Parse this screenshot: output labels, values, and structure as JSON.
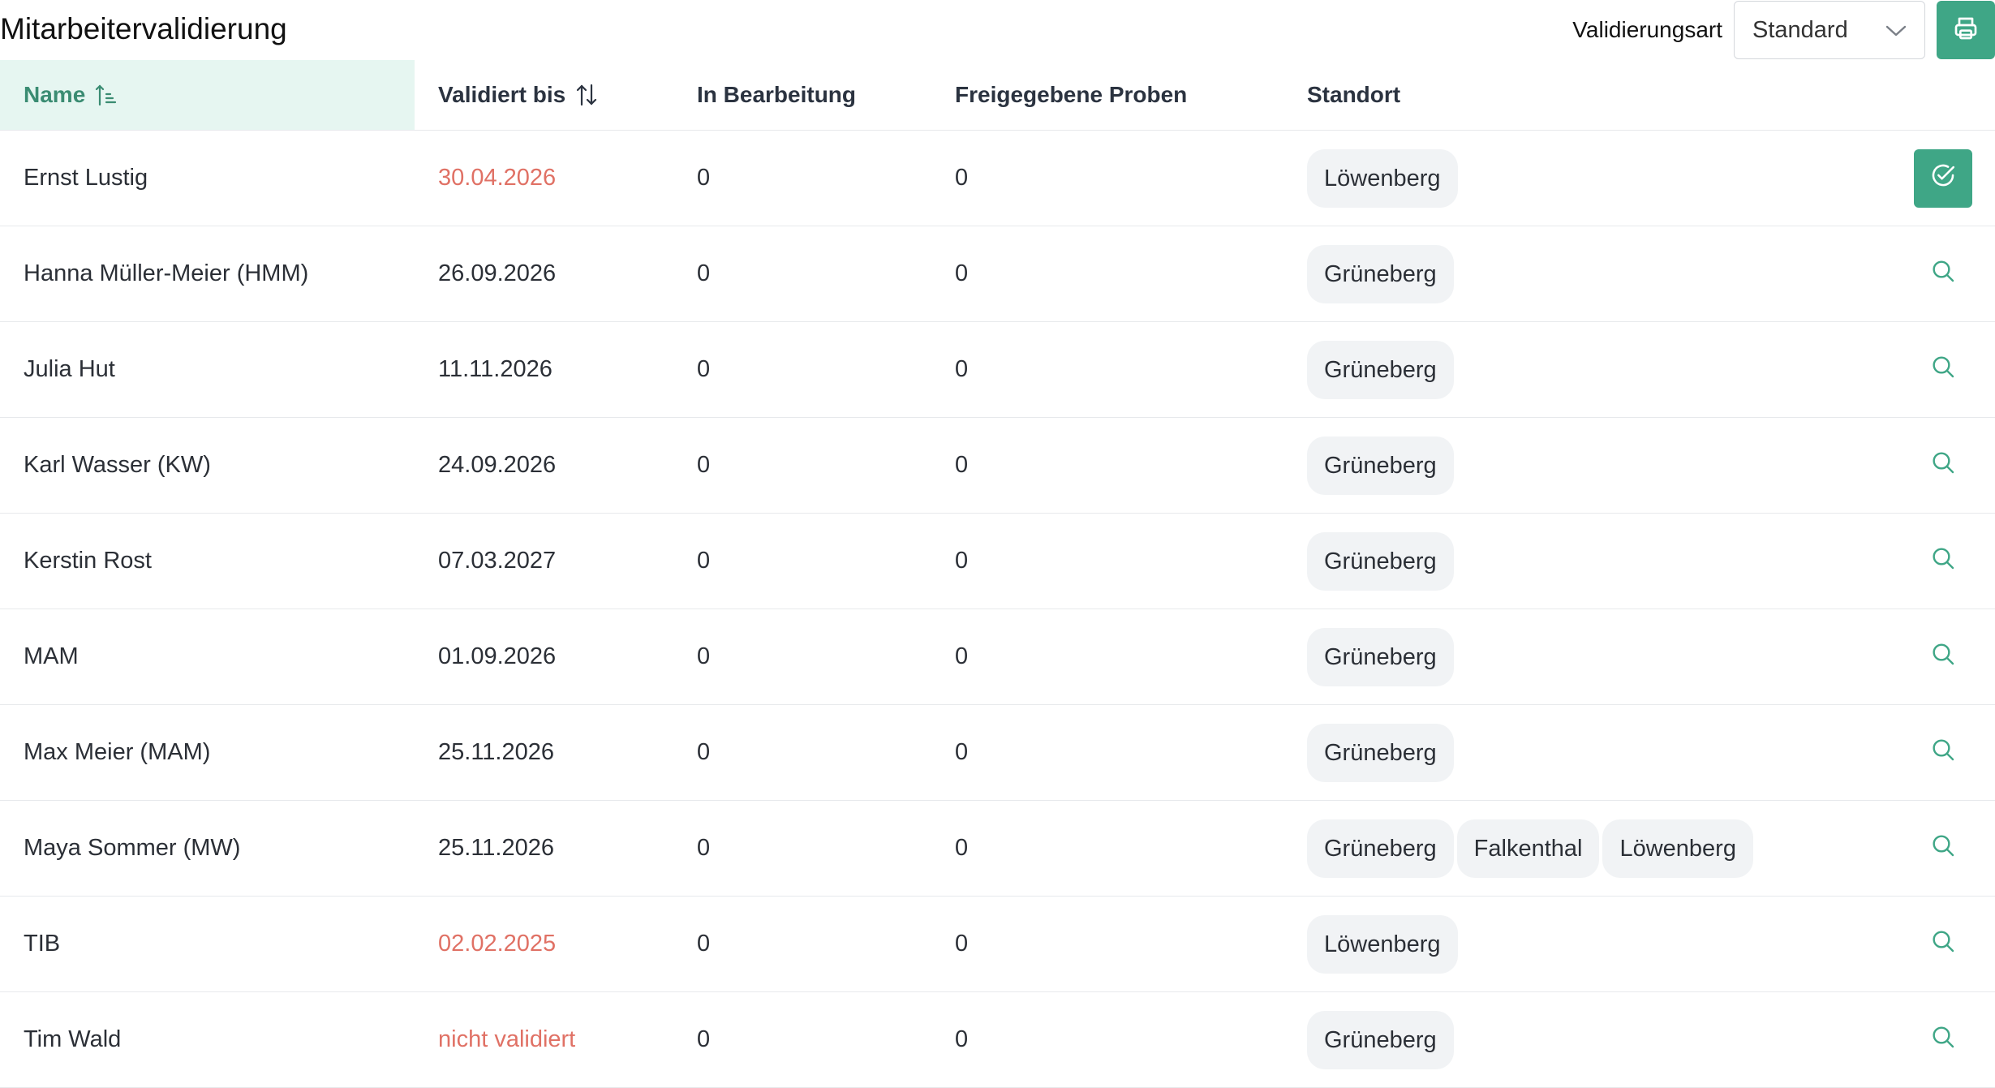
{
  "header": {
    "title": "Mitarbeitervalidierung",
    "validation_label": "Validierungsart",
    "validation_select": "Standard"
  },
  "table": {
    "columns": [
      "Name",
      "Validiert bis",
      "In Bearbeitung",
      "Freigegebene Proben",
      "Standort"
    ],
    "rows": [
      {
        "name": "Ernst Lustig",
        "valid_until": "30.04.2026",
        "in_progress": "0",
        "released": "0",
        "locations": [
          "Löwenberg"
        ]
      },
      {
        "name": "Hanna Müller-Meier (HMM)",
        "valid_until": "26.09.2026",
        "in_progress": "0",
        "released": "0",
        "locations": [
          "Grüneberg"
        ]
      },
      {
        "name": "Julia Hut",
        "valid_until": "11.11.2026",
        "in_progress": "0",
        "released": "0",
        "locations": [
          "Grüneberg"
        ]
      },
      {
        "name": "Karl Wasser (KW)",
        "valid_until": "24.09.2026",
        "in_progress": "0",
        "released": "0",
        "locations": [
          "Grüneberg"
        ]
      },
      {
        "name": "Kerstin Rost",
        "valid_until": "07.03.2027",
        "in_progress": "0",
        "released": "0",
        "locations": [
          "Grüneberg"
        ]
      },
      {
        "name": "MAM",
        "valid_until": "01.09.2026",
        "in_progress": "0",
        "released": "0",
        "locations": [
          "Grüneberg"
        ]
      },
      {
        "name": "Max Meier (MAM)",
        "valid_until": "25.11.2026",
        "in_progress": "0",
        "released": "0",
        "locations": [
          "Grüneberg"
        ]
      },
      {
        "name": "Maya Sommer (MW)",
        "valid_until": "25.11.2026",
        "in_progress": "0",
        "released": "0",
        "locations": [
          "Grüneberg",
          "Falkenthal",
          "Löwenberg"
        ]
      },
      {
        "name": "TIB",
        "valid_until": "02.02.2025",
        "in_progress": "0",
        "released": "0",
        "locations": [
          "Löwenberg"
        ]
      },
      {
        "name": "Tim Wald",
        "valid_until": "nicht validiert",
        "in_progress": "0",
        "released": "0",
        "locations": [
          "Grüneberg"
        ]
      }
    ]
  },
  "icons": {
    "print": "printer-icon",
    "select_arrow": "chevron-down-icon",
    "sort_name": "sort-ascending-icon",
    "sort_valid": "sort-both-icon",
    "row_action": "search-icon",
    "row_action_active": "check-circle-icon"
  },
  "colors": {
    "accent": "#3fa686",
    "accent_light": "#e6f6f1",
    "warning_text": "#e07165"
  }
}
